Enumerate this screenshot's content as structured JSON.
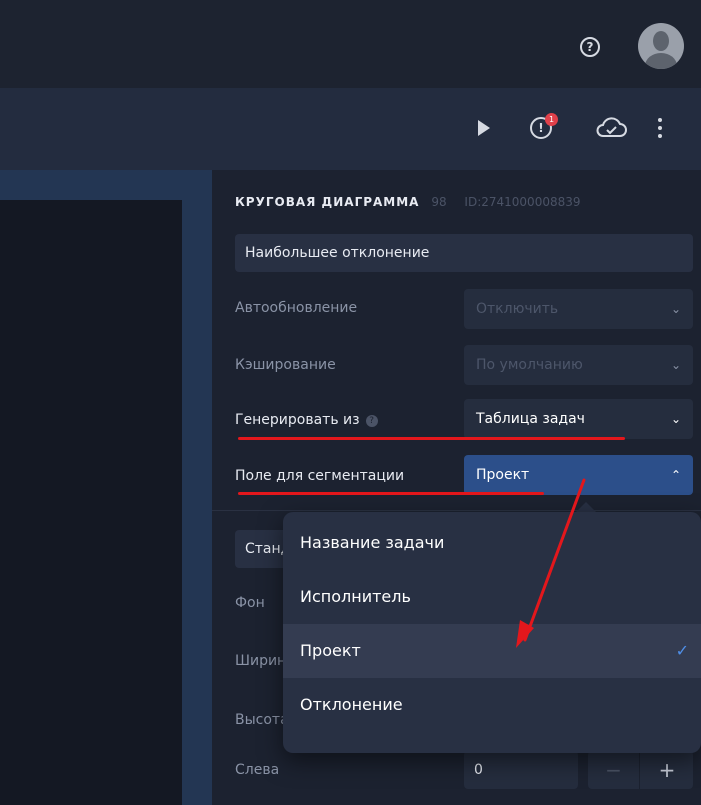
{
  "topbar": {
    "help_icon_glyph": "?",
    "avatar_icon": "user-avatar"
  },
  "toolbar": {
    "play_icon": "play-icon",
    "alert_glyph": "!",
    "alert_badge": "1",
    "cloud_icon": "cloud-check-icon",
    "more_icon": "more-vertical-icon"
  },
  "panel": {
    "title": "КРУГОВАЯ ДИАГРАММА",
    "count": "98",
    "id_label": "ID:2741000008839",
    "name_value": "Наибольшее отклонение",
    "rows": [
      {
        "label": "Автообновление",
        "value": "Отключить"
      },
      {
        "label": "Кэширование",
        "value": "По умолчанию"
      },
      {
        "label": "Генерировать из",
        "help": "?",
        "value": "Таблица задач"
      },
      {
        "label": "Поле для сегментации",
        "value": "Проект"
      }
    ],
    "style_field_value": "Стандартный",
    "labels": {
      "background": "Фон",
      "width": "Ширина",
      "height": "Высота",
      "left": "Слева"
    },
    "left_value": "0",
    "stepper": {
      "minus": "−",
      "plus": "+"
    }
  },
  "dropdown": {
    "items": [
      {
        "label": "Название задачи"
      },
      {
        "label": "Исполнитель"
      },
      {
        "label": "Проект",
        "check": "✓"
      },
      {
        "label": "Отклонение"
      }
    ]
  },
  "colors": {
    "accent_annotation": "#e3171c",
    "selected_check": "#4f8fe8",
    "open_select": "#2c4f8a"
  }
}
